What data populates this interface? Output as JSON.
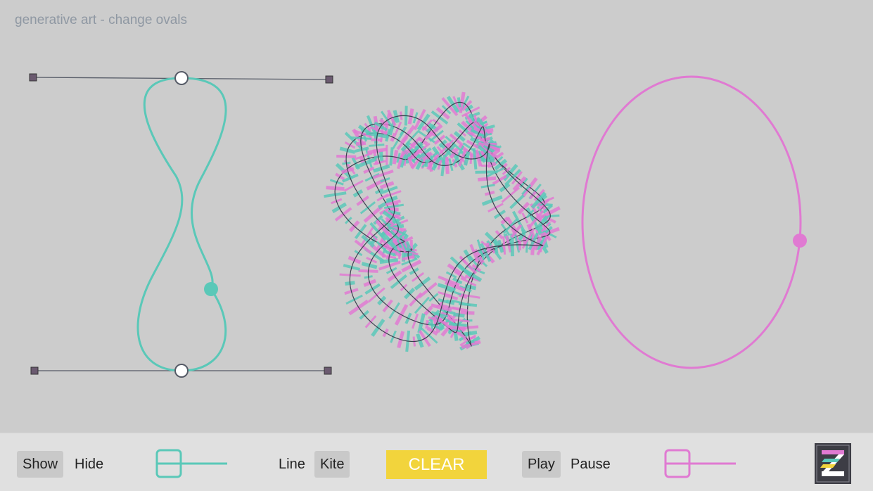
{
  "header": {
    "title": "generative art - change ovals"
  },
  "toolbar": {
    "show_label": "Show",
    "hide_label": "Hide",
    "line_label": "Line",
    "kite_label": "Kite",
    "clear_label": "CLEAR",
    "play_label": "Play",
    "pause_label": "Pause"
  },
  "colors": {
    "teal": "#5ac8b8",
    "pink": "#e07ad2",
    "clear_yellow": "#f2d43c",
    "background": "#cccccc",
    "toolbar_bg": "#e0e0e0"
  },
  "icons": {
    "logo": "zim-logo-icon",
    "control_handle": "square-handle-icon",
    "anchor_point": "circle-anchor-icon"
  }
}
